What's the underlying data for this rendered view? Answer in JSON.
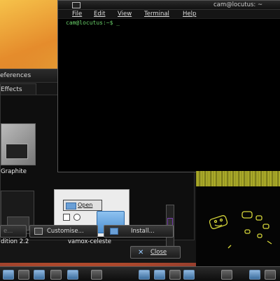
{
  "terminal": {
    "title": "cam@locutus: ~",
    "menu": [
      "File",
      "Edit",
      "View",
      "Terminal",
      "Help"
    ],
    "prompt": "cam@locutus:~$ _"
  },
  "prefs": {
    "title_partial": "eferences",
    "tab_effects": "Effects",
    "themes": [
      {
        "label": "Graphite"
      },
      {
        "label": "dition 2.2"
      },
      {
        "label": "vamox-celeste",
        "open_label": "Open"
      }
    ],
    "buttons": {
      "remove": "e...",
      "customise": "Customise...",
      "install": "Install...",
      "close": "Close"
    }
  },
  "colors": {
    "prompt": "#6ad16a",
    "scroll_accent": "#7a3fb0",
    "doodle": "#d6d63a"
  }
}
